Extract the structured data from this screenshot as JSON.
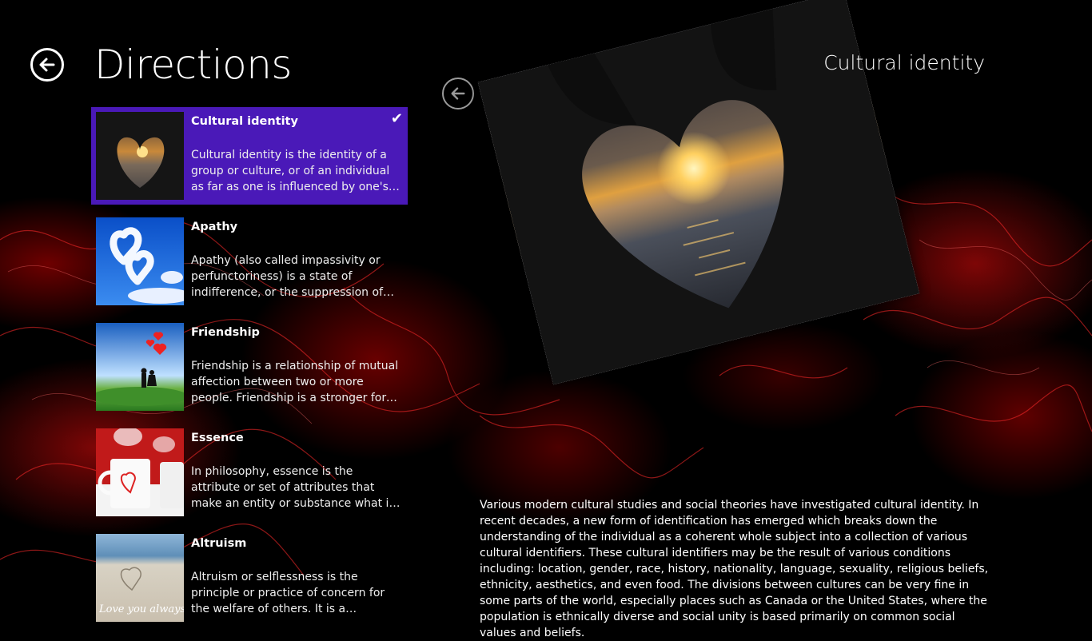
{
  "header": {
    "title": "Directions"
  },
  "list": {
    "items": [
      {
        "title": "Cultural identity",
        "description": "Cultural identity is the identity of a group or culture, or of an individual as far as one is influenced by one's belonging to...",
        "selected": true
      },
      {
        "title": "Apathy",
        "description": "Apathy (also called impassivity or perfunctoriness) is a state of indifference, or the suppression of emotions such as...",
        "selected": false
      },
      {
        "title": "Friendship",
        "description": "Friendship is a relationship of mutual affection between two or more people. Friendship is a stronger form of...",
        "selected": false
      },
      {
        "title": "Essence",
        "description": "In philosophy, essence is the attribute or set of attributes that make an entity or substance what it fundamentally is, and...",
        "selected": false
      },
      {
        "title": "Altruism",
        "description": "Altruism or selflessness is the principle or practice of concern for the welfare of others. It is a traditional virtue in many...",
        "selected": false
      }
    ],
    "check_glyph": "✔"
  },
  "detail": {
    "title": "Cultural identity",
    "body": "Various modern cultural studies and social theories have investigated cultural identity. In recent decades, a new form of identification has emerged which breaks down the understanding of the individual as a coherent whole subject into a collection of various cultural identifiers. These cultural identifiers may be the result of various conditions including: location, gender, race, history, nationality, language, sexuality, religious beliefs, ethnicity, aesthetics, and even food. The divisions between cultures can be very fine in some parts of the world, especially places such as Canada or the United States, where the population is ethnically diverse and social unity is based primarily on common social values and beliefs."
  },
  "thumbnail_captions": {
    "altruism": "Love you always"
  },
  "icons": {
    "back_main": "arrow-left-circle-icon",
    "back_detail": "arrow-left-circle-icon",
    "selected_check": "checkmark-icon"
  },
  "colors": {
    "background": "#000000",
    "selection": "#4a19b8",
    "accent_red": "#d40000"
  }
}
